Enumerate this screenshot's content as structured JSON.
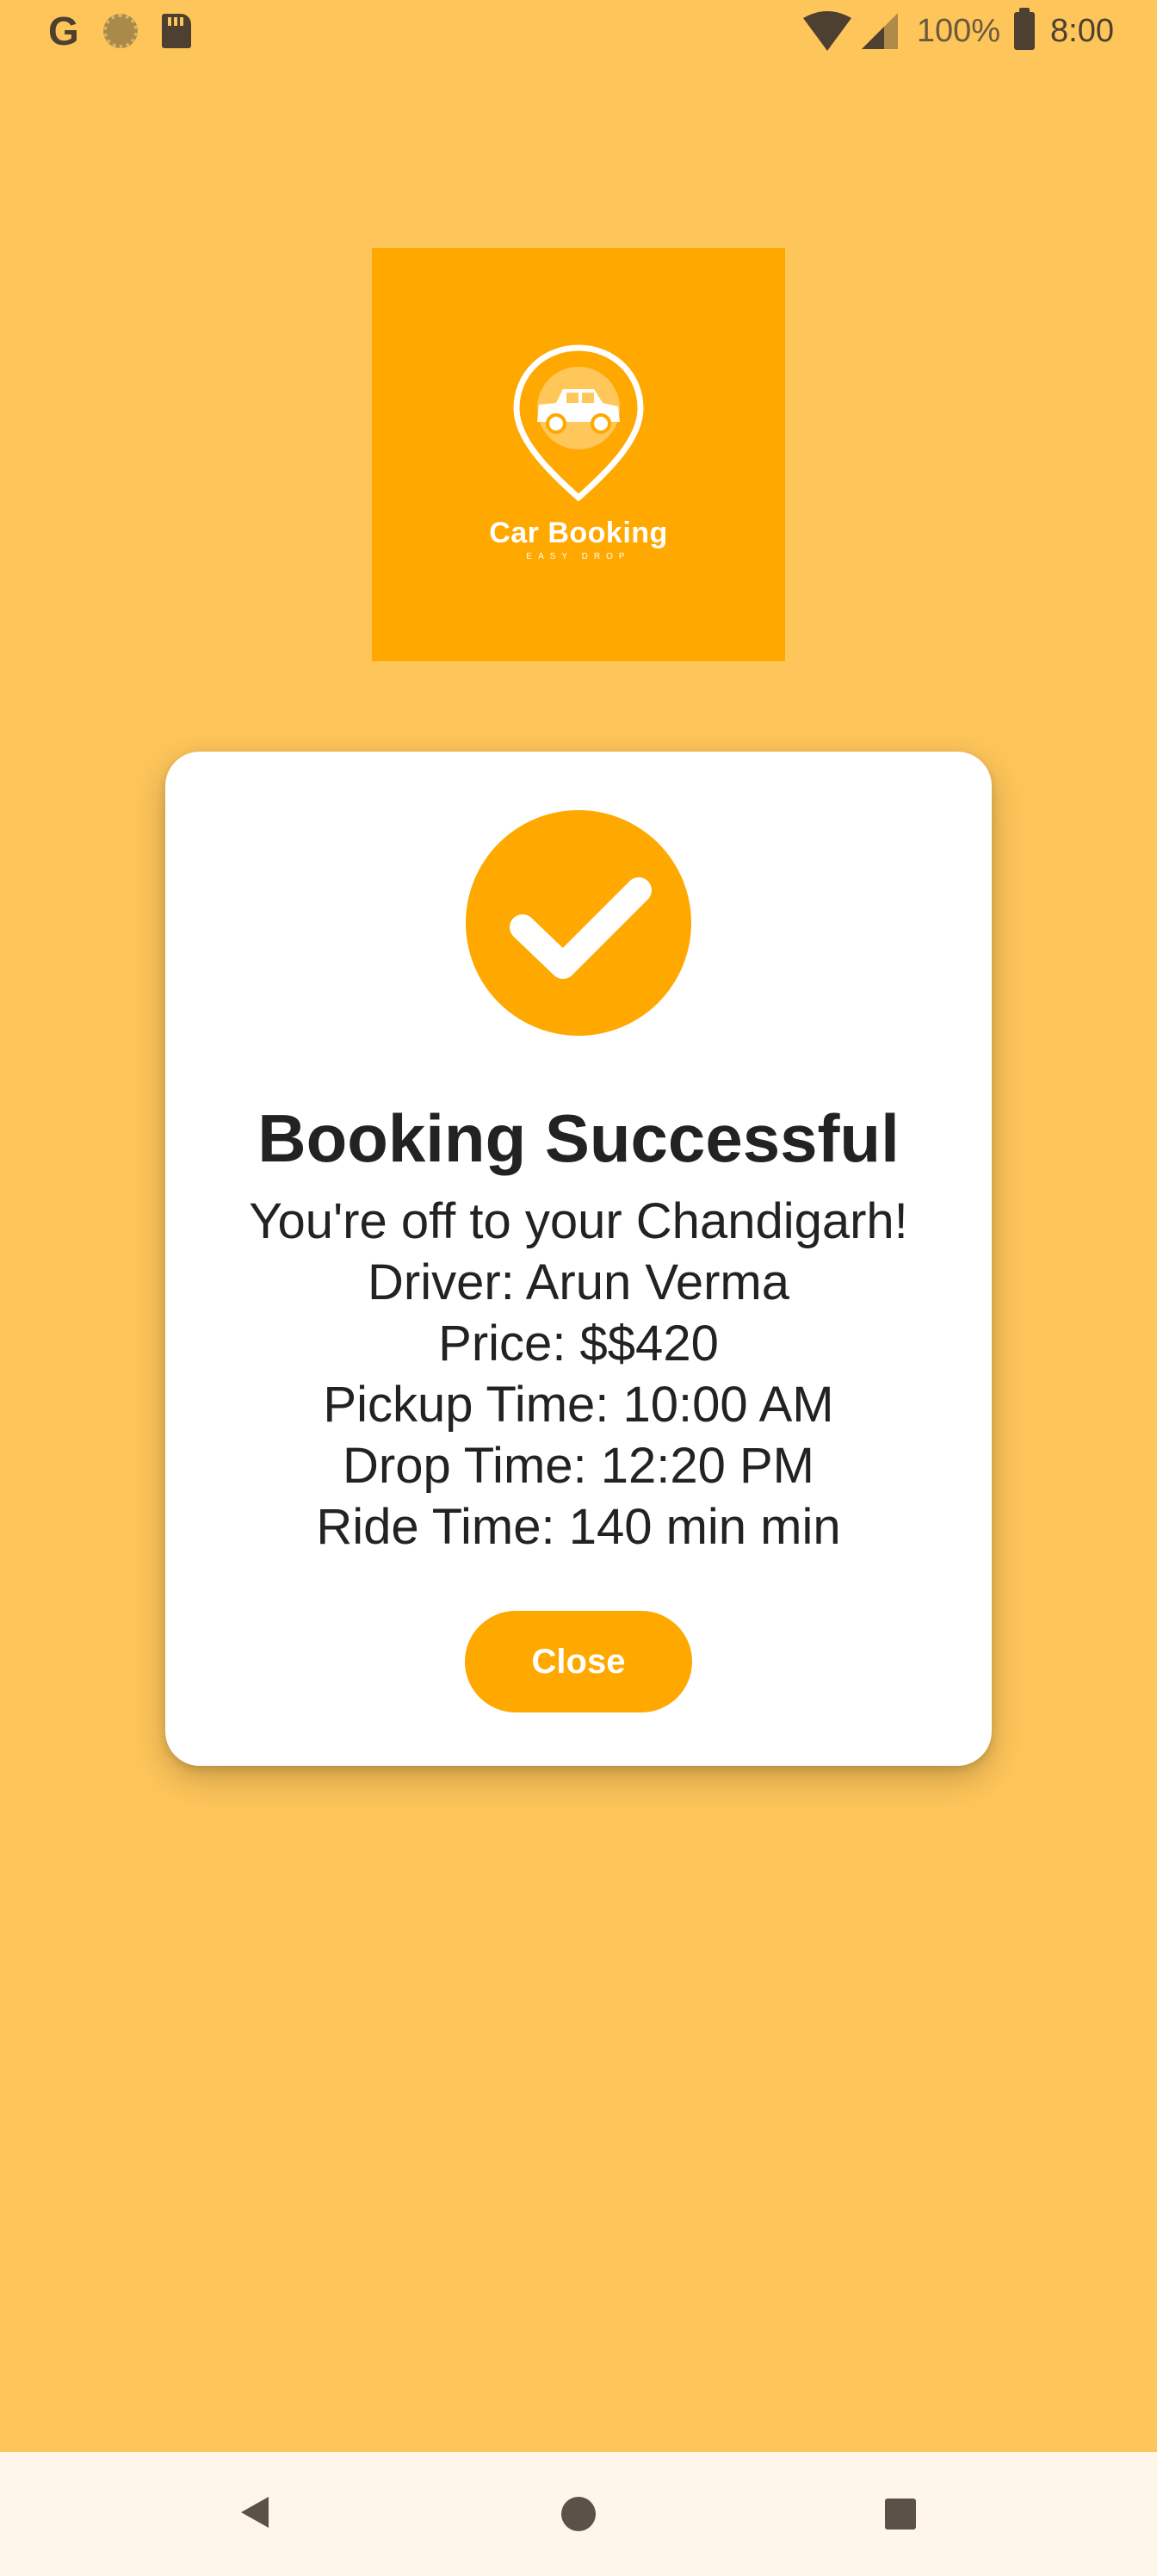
{
  "status_bar": {
    "left_icons": [
      "google-icon",
      "sun-icon",
      "sd-card-icon"
    ],
    "battery": "100%",
    "time": "8:00"
  },
  "logo": {
    "title": "Car Booking",
    "subtitle": "EASY DROP"
  },
  "dialog": {
    "title": "Booking Successful",
    "lines": [
      "You're off to your Chandigarh!",
      "Driver: Arun Verma",
      "Price: $$420",
      "Pickup Time: 10:00 AM",
      "Drop Time: 12:20 PM",
      "Ride Time: 140 min min"
    ],
    "close_label": "Close"
  },
  "colors": {
    "background": "#FEC55A",
    "accent": "#FEA800",
    "dialog": "#FFFFFF",
    "nav_bar": "#FFF6EA"
  },
  "nav_bar": {
    "buttons": [
      "back-icon",
      "home-icon",
      "recents-icon"
    ]
  }
}
